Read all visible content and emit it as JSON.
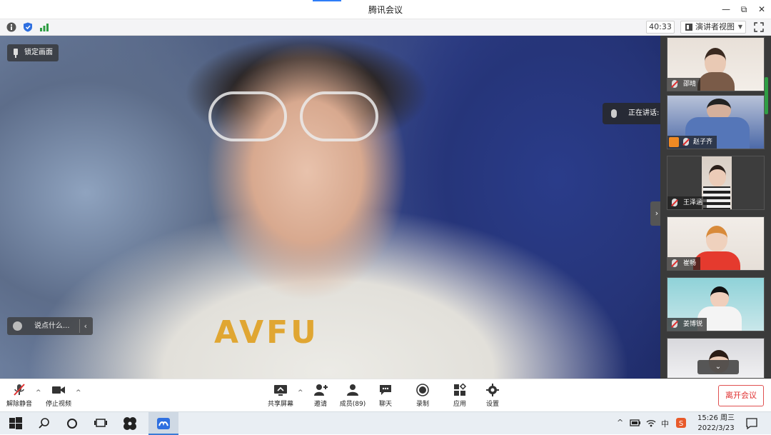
{
  "window": {
    "title": "腾讯会议",
    "controls": {
      "minimize": "—",
      "restore": "⧉",
      "close": "✕"
    }
  },
  "infobar": {
    "icons": [
      "info-icon",
      "shield-icon",
      "signal-icon"
    ],
    "timer": "40:33",
    "view_mode": "演讲者视图",
    "fullscreen_icon": "fullscreen-icon"
  },
  "main_video": {
    "lock_label": "锁定画面",
    "chat_placeholder": "说点什么...",
    "shirt_text": "AVFU"
  },
  "speaking": {
    "label": "正在讲话: 刘家科;"
  },
  "participants": [
    {
      "name": "邵晴"
    },
    {
      "name": "赵子齐"
    },
    {
      "name": "王泽涵"
    },
    {
      "name": "崔畅"
    },
    {
      "name": "姜博锐"
    },
    {
      "name": ""
    }
  ],
  "toolbar": {
    "mute_label": "解除静音",
    "video_label": "停止视频",
    "share_label": "共享屏幕",
    "invite_label": "邀请",
    "members_label": "成员(89)",
    "chat_label": "聊天",
    "record_label": "录制",
    "apps_label": "应用",
    "settings_label": "设置",
    "leave_label": "离开会议"
  },
  "taskbar": {
    "time": "15:26 周三",
    "date": "2022/3/23",
    "ime": "中",
    "accent": "#3a7bd5"
  },
  "colors": {
    "leave": "#e03030",
    "active_signal": "#2f9e44"
  }
}
